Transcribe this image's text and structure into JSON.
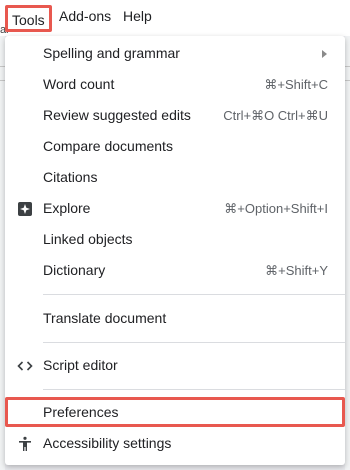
{
  "menubar": {
    "edge_fragment": "al",
    "tools": "Tools",
    "addons": "Add-ons",
    "help": "Help"
  },
  "menu": {
    "items": [
      {
        "label": "Spelling and grammar",
        "shortcut": ""
      },
      {
        "label": "Word count",
        "shortcut": "⌘+Shift+C"
      },
      {
        "label": "Review suggested edits",
        "shortcut": "Ctrl+⌘O Ctrl+⌘U"
      },
      {
        "label": "Compare documents",
        "shortcut": ""
      },
      {
        "label": "Citations",
        "shortcut": ""
      },
      {
        "label": "Explore",
        "shortcut": "⌘+Option+Shift+I"
      },
      {
        "label": "Linked objects",
        "shortcut": ""
      },
      {
        "label": "Dictionary",
        "shortcut": "⌘+Shift+Y"
      },
      {
        "label": "Translate document",
        "shortcut": ""
      },
      {
        "label": "Script editor",
        "shortcut": ""
      },
      {
        "label": "Preferences",
        "shortcut": ""
      },
      {
        "label": "Accessibility settings",
        "shortcut": ""
      }
    ]
  },
  "colors": {
    "highlight_border": "#e8584f",
    "text": "#202124",
    "shortcut_text": "#5f6368"
  }
}
